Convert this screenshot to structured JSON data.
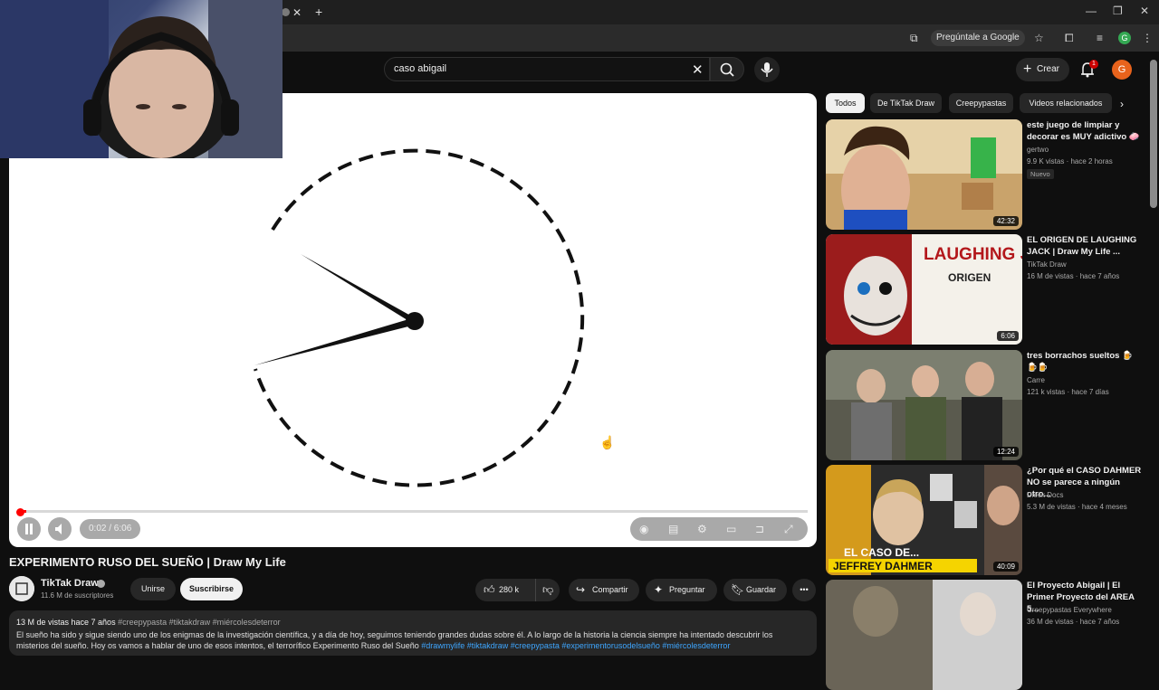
{
  "browser": {
    "ask_google": "Pregúntale a Google",
    "profile_initial": "G"
  },
  "header": {
    "search_query": "caso abigail",
    "create_label": "Crear",
    "notification_count": "1",
    "account_initial": "G"
  },
  "player": {
    "time": "0:02 / 6:06",
    "progress_fraction": 0.006
  },
  "video": {
    "title": "EXPERIMENTO RUSO DEL SUEÑO | Draw My Life",
    "channel": "TikTak Draw",
    "subscribers": "11.6 M de suscriptores",
    "join_label": "Unirse",
    "subscribe_label": "Suscribirse",
    "likes": "280 k",
    "share_label": "Compartir",
    "ask_label": "Preguntar",
    "save_label": "Guardar",
    "views_age": "13 M de vistas  hace 7 años",
    "meta_tags": "#creepypasta #tiktakdraw #miércolesdeterror",
    "description": "El sueño ha sido y sigue siendo uno de los enigmas de la investigación científica, y a día de hoy, seguimos teniendo grandes dudas sobre él. A lo largo de la historia la ciencia siempre ha intentado descubrir los misterios del sueño. Hoy os vamos a hablar de uno de esos intentos, el terrorífico Experimento Ruso del Sueño",
    "description_tags": "#drawmylife #tiktakdraw #creepypasta #experimentorusodelsueño #miércolesdeterror"
  },
  "sidebar": {
    "chips": [
      "Todos",
      "De TikTak Draw",
      "Creepypastas",
      "Videos relacionados"
    ],
    "recommendations": [
      {
        "title": "este juego de limpiar y decorar es MUY adictivo 🧼",
        "channel": "gertwo",
        "stats": "9.9 K vistas · hace 2 horas",
        "badge": "Nuevo",
        "duration": "42:32"
      },
      {
        "title": "EL ORIGEN DE LAUGHING JACK | Draw My Life ...",
        "channel": "TikTak Draw",
        "stats": "16 M de vistas · hace 7 años",
        "badge": "",
        "duration": "6:06",
        "thumb_text": "LAUGHING JACK",
        "thumb_sub": "ORIGEN"
      },
      {
        "title": "tres borrachos sueltos 🍺🍺🍺",
        "channel": "Carre",
        "stats": "121 k vistas · hace 7 días",
        "badge": "",
        "duration": "12:24"
      },
      {
        "title": "¿Por qué el CASO DAHMER NO se parece a ningún otro...",
        "channel": "Dieck Docs",
        "stats": "5.3 M de vistas · hace 4 meses",
        "badge": "",
        "duration": "40:09",
        "thumb_text": "EL CASO DE...",
        "thumb_sub": "JEFFREY DAHMER"
      },
      {
        "title": "El Proyecto Abigail | El Primer Proyecto del AREA 5...",
        "channel": "Creepypastas Everywhere",
        "stats": "36 M de vistas · hace 7 años",
        "badge": "",
        "duration": ""
      }
    ]
  },
  "colors": {
    "background": "#0f0f0f",
    "accent_red": "#ff0000",
    "link_blue": "#3ea6ff"
  }
}
